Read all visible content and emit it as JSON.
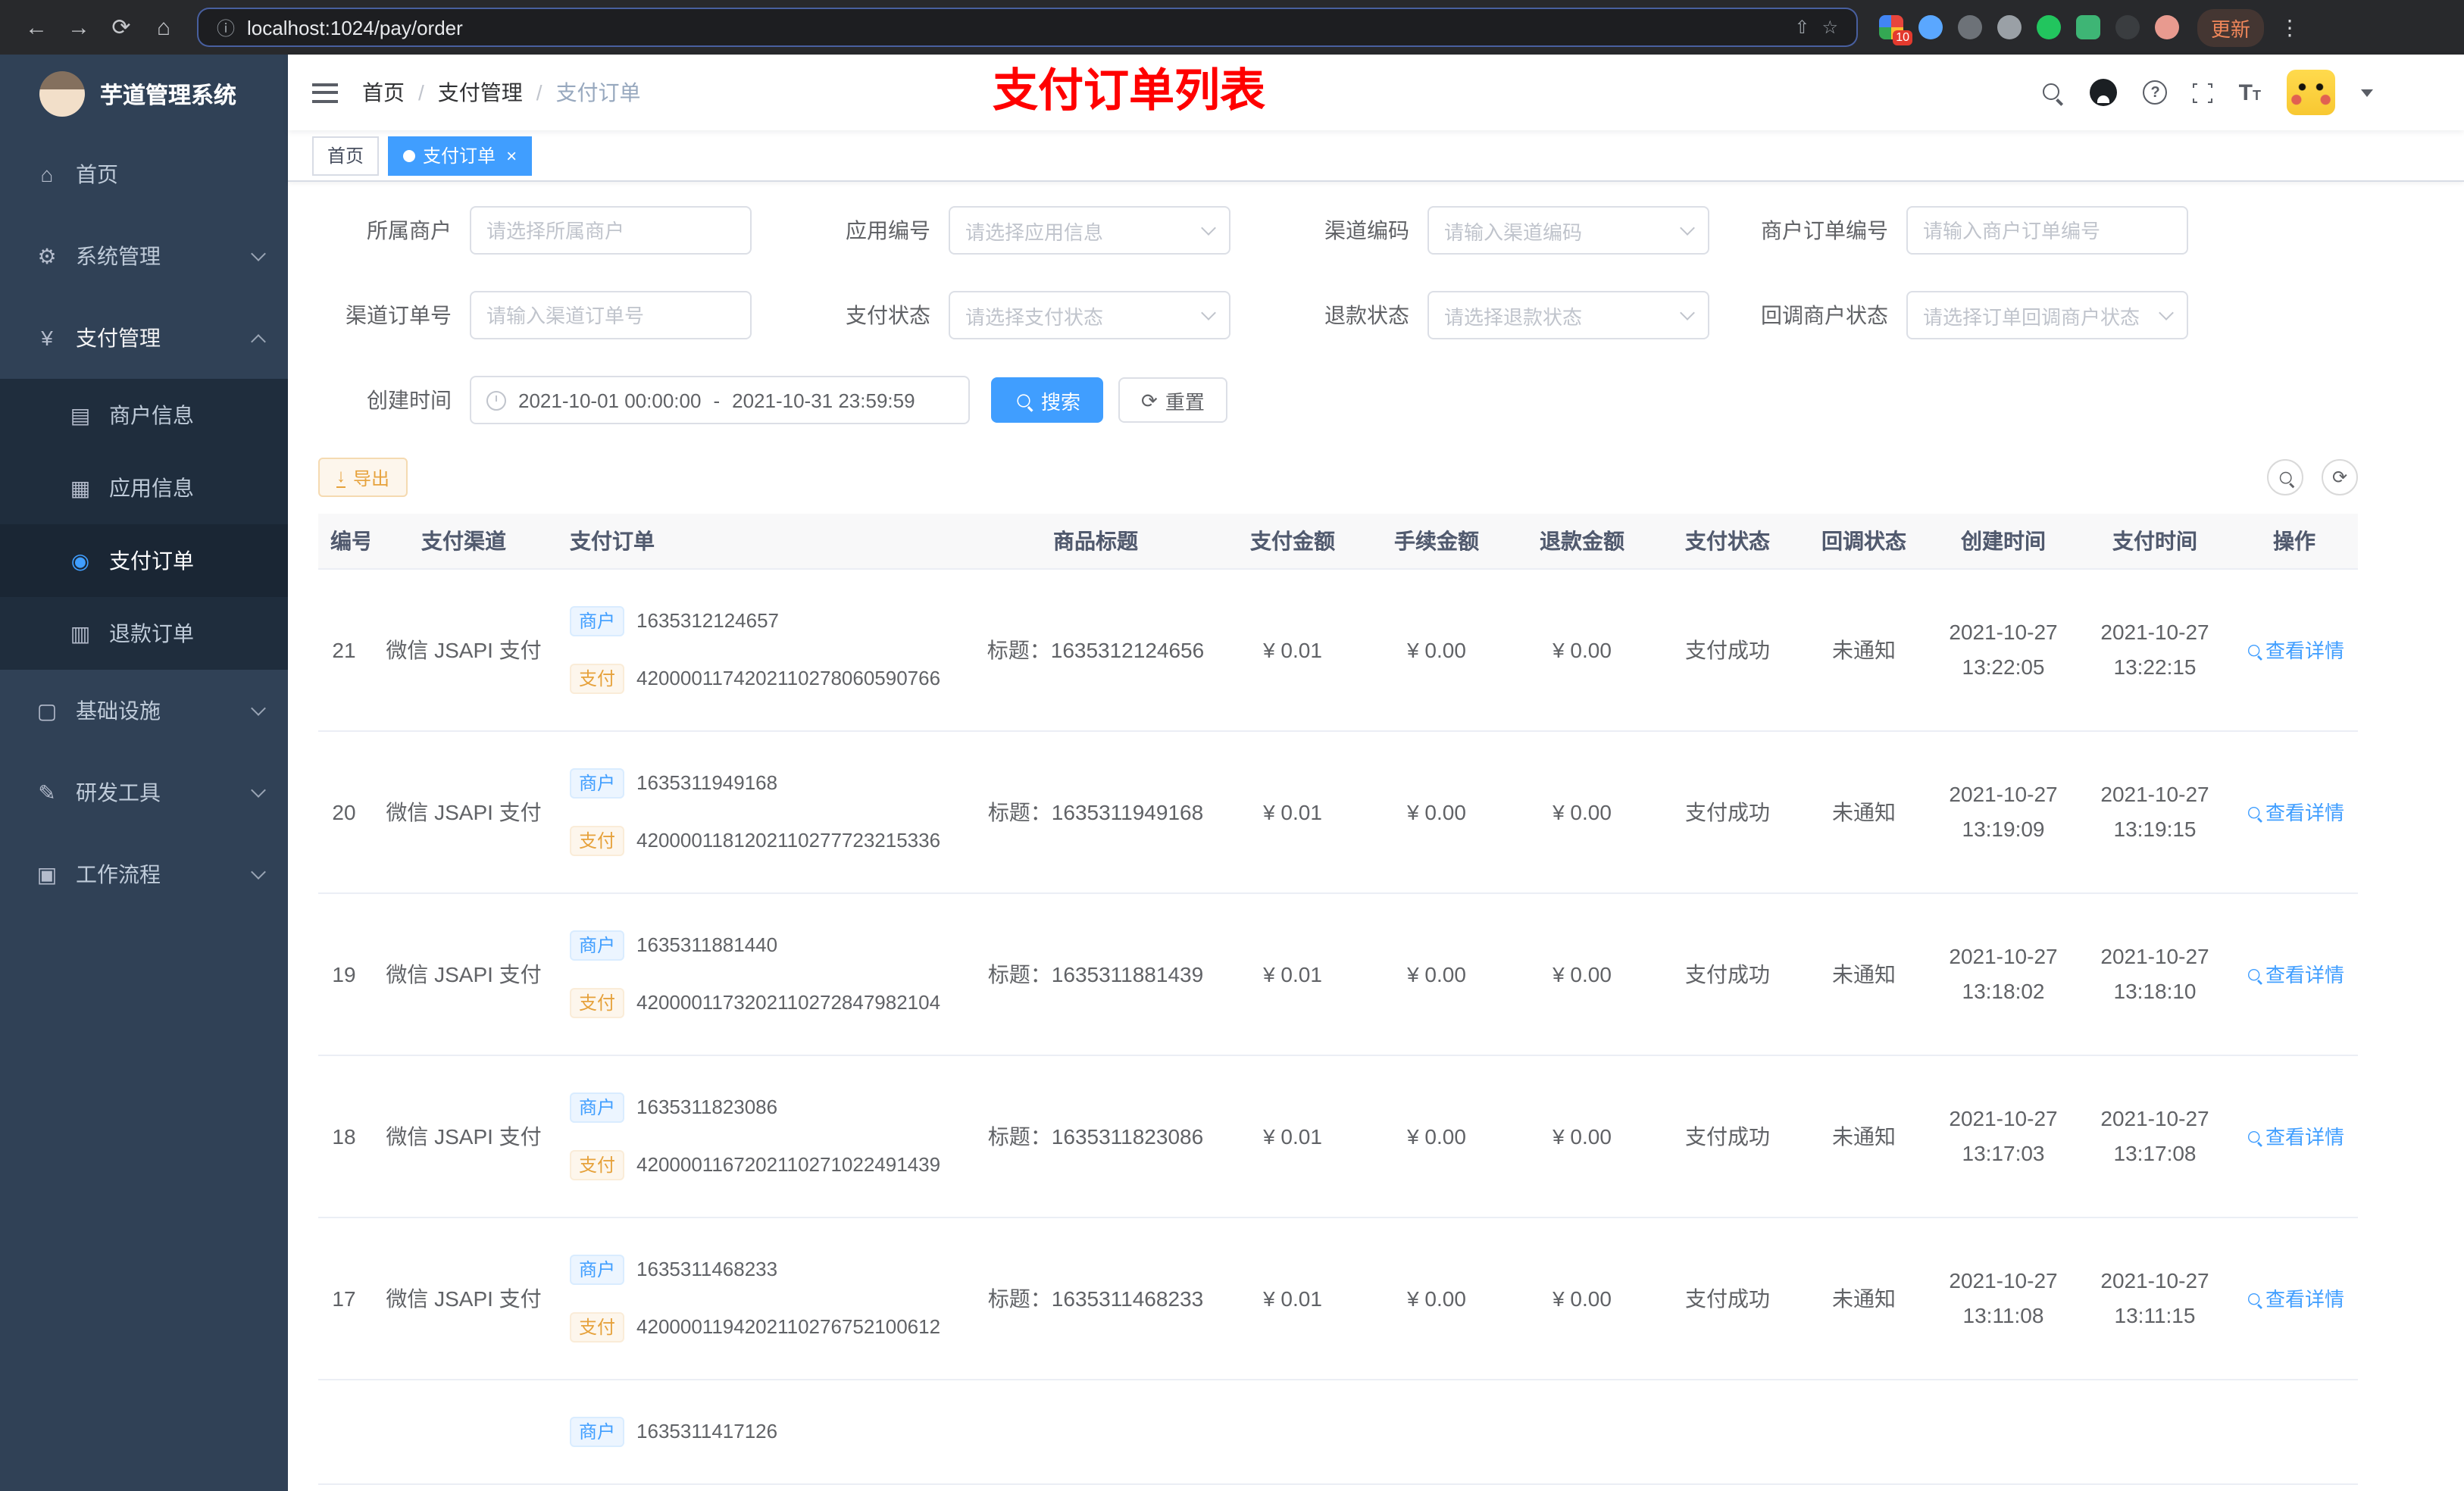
{
  "browser": {
    "url": "localhost:1024/pay/order",
    "update_label": "更新",
    "extensions_badge": "10"
  },
  "icons": {
    "back": "←",
    "forward": "→",
    "refresh": "⟳",
    "home": "⌂",
    "info": "ⓘ",
    "share": "⇧",
    "star": "☆",
    "dots": "⋮",
    "close": "×",
    "download": "↓",
    "question": "?",
    "font_big": "T",
    "font_small": "T",
    "menu_home": "⌂",
    "menu_system": "⚙",
    "menu_pay": "¥",
    "menu_merchant": "▤",
    "menu_app": "▦",
    "menu_order": "◉",
    "menu_refund": "▥",
    "menu_infra": "▢",
    "menu_tool": "✎",
    "menu_flow": "▣"
  },
  "sidebar": {
    "logo_title": "芋道管理系统",
    "menu": [
      {
        "label": "首页"
      },
      {
        "label": "系统管理"
      },
      {
        "label": "支付管理"
      },
      {
        "label": "基础设施"
      },
      {
        "label": "研发工具"
      },
      {
        "label": "工作流程"
      }
    ],
    "submenu": [
      {
        "label": "商户信息"
      },
      {
        "label": "应用信息"
      },
      {
        "label": "支付订单"
      },
      {
        "label": "退款订单"
      }
    ]
  },
  "header": {
    "breadcrumb": [
      "首页",
      "支付管理",
      "支付订单"
    ],
    "breadcrumb_separator": "/",
    "annotation": "支付订单列表"
  },
  "tabs": [
    {
      "label": "首页"
    },
    {
      "label": "支付订单"
    }
  ],
  "filters": {
    "fields": [
      {
        "label": "所属商户",
        "placeholder": "请选择所属商户"
      },
      {
        "label": "应用编号",
        "placeholder": "请选择应用信息"
      },
      {
        "label": "渠道编码",
        "placeholder": "请输入渠道编码"
      },
      {
        "label": "商户订单编号",
        "placeholder": "请输入商户订单编号"
      },
      {
        "label": "渠道订单号",
        "placeholder": "请输入渠道订单号"
      },
      {
        "label": "支付状态",
        "placeholder": "请选择支付状态"
      },
      {
        "label": "退款状态",
        "placeholder": "请选择退款状态"
      },
      {
        "label": "回调商户状态",
        "placeholder": "请选择订单回调商户状态"
      }
    ],
    "create_time": {
      "label": "创建时间",
      "start": "2021-10-01 00:00:00",
      "separator": "-",
      "end": "2021-10-31 23:59:59"
    },
    "search_label": "搜索",
    "reset_label": "重置"
  },
  "toolbar": {
    "export_label": "导出"
  },
  "table": {
    "columns": [
      "编号",
      "支付渠道",
      "支付订单",
      "商品标题",
      "支付金额",
      "手续金额",
      "退款金额",
      "支付状态",
      "回调状态",
      "创建时间",
      "支付时间",
      "操作"
    ],
    "tags": {
      "merchant": "商户",
      "pay": "支付"
    },
    "rows": [
      {
        "id": "21",
        "channel": "微信 JSAPI 支付",
        "merchant_no": "1635312124657",
        "pay_no": "4200001174202110278060590766",
        "title": "标题：1635312124656",
        "amount": "¥ 0.01",
        "fee": "¥ 0.00",
        "refund": "¥ 0.00",
        "status": "支付成功",
        "notify": "未通知",
        "create_time": "2021-10-27 13:22:05",
        "pay_time": "2021-10-27 13:22:15",
        "action": "查看详情"
      },
      {
        "id": "20",
        "channel": "微信 JSAPI 支付",
        "merchant_no": "1635311949168",
        "pay_no": "4200001181202110277723215336",
        "title": "标题：1635311949168",
        "amount": "¥ 0.01",
        "fee": "¥ 0.00",
        "refund": "¥ 0.00",
        "status": "支付成功",
        "notify": "未通知",
        "create_time": "2021-10-27 13:19:09",
        "pay_time": "2021-10-27 13:19:15",
        "action": "查看详情"
      },
      {
        "id": "19",
        "channel": "微信 JSAPI 支付",
        "merchant_no": "1635311881440",
        "pay_no": "4200001173202110272847982104",
        "title": "标题：1635311881439",
        "amount": "¥ 0.01",
        "fee": "¥ 0.00",
        "refund": "¥ 0.00",
        "status": "支付成功",
        "notify": "未通知",
        "create_time": "2021-10-27 13:18:02",
        "pay_time": "2021-10-27 13:18:10",
        "action": "查看详情"
      },
      {
        "id": "18",
        "channel": "微信 JSAPI 支付",
        "merchant_no": "1635311823086",
        "pay_no": "4200001167202110271022491439",
        "title": "标题：1635311823086",
        "amount": "¥ 0.01",
        "fee": "¥ 0.00",
        "refund": "¥ 0.00",
        "status": "支付成功",
        "notify": "未通知",
        "create_time": "2021-10-27 13:17:03",
        "pay_time": "2021-10-27 13:17:08",
        "action": "查看详情"
      },
      {
        "id": "17",
        "channel": "微信 JSAPI 支付",
        "merchant_no": "1635311468233",
        "pay_no": "4200001194202110276752100612",
        "title": "标题：1635311468233",
        "amount": "¥ 0.01",
        "fee": "¥ 0.00",
        "refund": "¥ 0.00",
        "status": "支付成功",
        "notify": "未通知",
        "create_time": "2021-10-27 13:11:08",
        "pay_time": "2021-10-27 13:11:15",
        "action": "查看详情"
      },
      {
        "id": "",
        "channel": "",
        "merchant_no": "1635311417126",
        "pay_no": "",
        "title": "",
        "amount": "",
        "fee": "",
        "refund": "",
        "status": "",
        "notify": "",
        "create_time": "",
        "pay_time": "",
        "action": ""
      }
    ]
  }
}
